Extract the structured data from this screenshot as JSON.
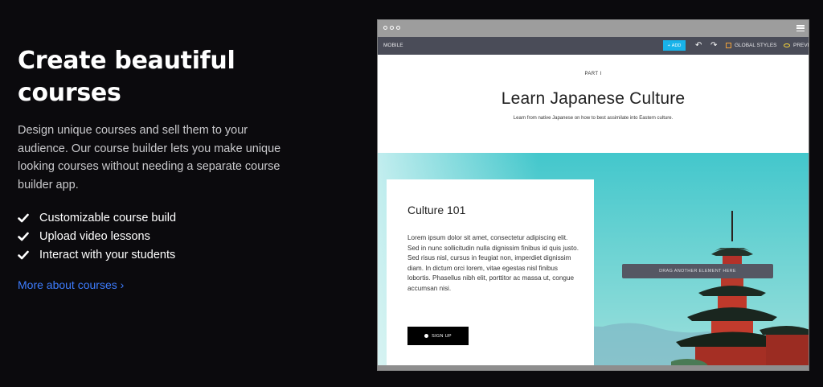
{
  "left": {
    "headline_line1": "Create beautiful",
    "headline_line2": "courses",
    "description": "Design unique courses and sell them to your audience. Our course builder lets you make unique looking courses without needing a separate course builder app.",
    "features": [
      "Customizable course build",
      "Upload video lessons",
      "Interact with your students"
    ],
    "more_link": "More about courses ›"
  },
  "mockup": {
    "toolbar": {
      "mobile_label": "MOBILE",
      "add_label": "ADD",
      "undo_icon": "undo-icon",
      "redo_icon": "redo-icon",
      "global_styles_label": "GLOBAL STYLES",
      "preview_label": "PREVI"
    },
    "page": {
      "part": "PART I",
      "title": "Learn Japanese Culture",
      "subtitle": "Learn from native Japanese on how to best assimilate into Eastern culture.",
      "card": {
        "title": "Culture 101",
        "body": "Lorem ipsum dolor sit amet, consectetur adipiscing elit. Sed in nunc sollicitudin nulla dignissim finibus id quis justo. Sed risus nisl, cursus in feugiat non, imperdiet dignissim diam. In dictum orci lorem, vitae egestas nisl finibus lobortis. Phasellus nibh elit, porttitor ac massa ut, congue accumsan nisi.",
        "button": "SIGN UP"
      },
      "drag_hint": "DRAG ANOTHER ELEMENT HERE"
    }
  },
  "colors": {
    "background": "#0b0a0d",
    "link": "#3e7dff",
    "add_button": "#18b3ea",
    "toolbar": "#4a4c58"
  }
}
